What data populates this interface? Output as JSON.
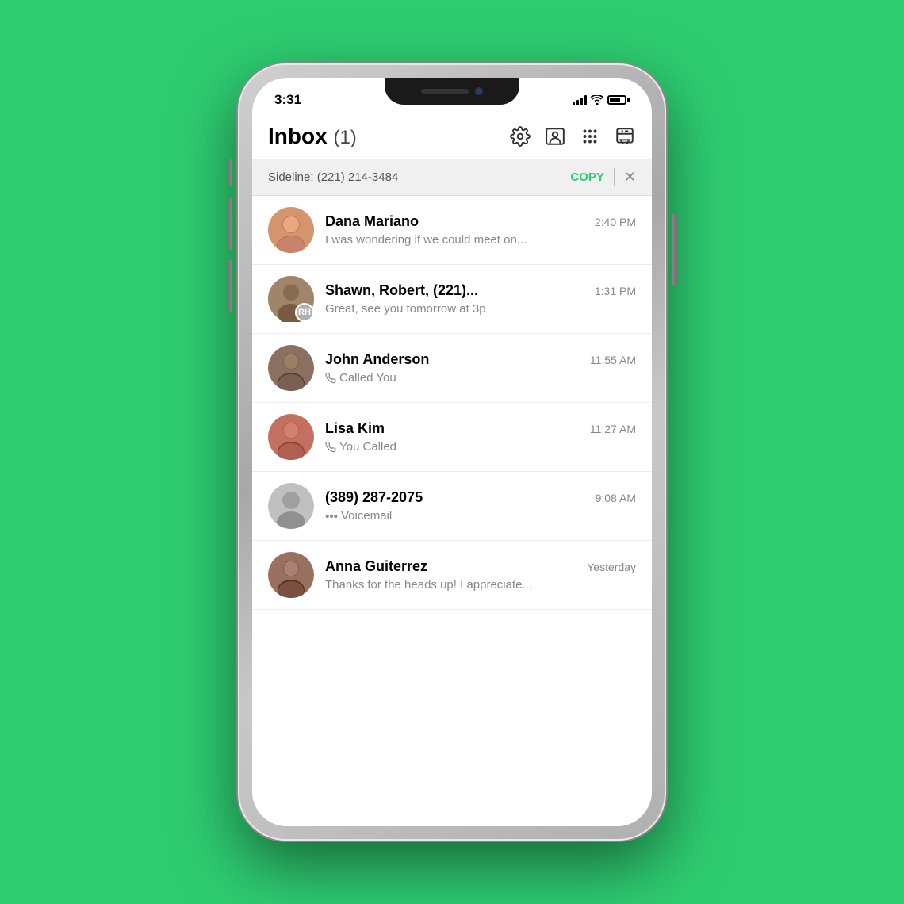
{
  "background_color": "#2ecc71",
  "status_bar": {
    "time": "3:31"
  },
  "header": {
    "title": "Inbox",
    "count": "(1)"
  },
  "sideline_banner": {
    "label": "Sideline: (221) 214-3484",
    "copy_btn": "COPY"
  },
  "conversations": [
    {
      "id": "dana",
      "name": "Dana Mariano",
      "time": "2:40 PM",
      "preview": "I was wondering if we could meet on...",
      "has_phone_icon": false,
      "unread": true,
      "avatar_type": "photo",
      "avatar_color": "#c9956a"
    },
    {
      "id": "shawn",
      "name": "Shawn, Robert, (221)...",
      "time": "1:31 PM",
      "preview": "Great, see you tomorrow at 3p",
      "has_phone_icon": false,
      "unread": false,
      "avatar_type": "initials",
      "avatar_initials": "RH",
      "avatar_color": "#a0856a"
    },
    {
      "id": "john",
      "name": "John Anderson",
      "time": "11:55 AM",
      "preview": "Called You",
      "has_phone_icon": true,
      "unread": false,
      "avatar_type": "photo",
      "avatar_color": "#8a6a4a"
    },
    {
      "id": "lisa",
      "name": "Lisa Kim",
      "time": "11:27 AM",
      "preview": "You Called",
      "has_phone_icon": true,
      "unread": false,
      "avatar_type": "photo",
      "avatar_color": "#c47060"
    },
    {
      "id": "unknown",
      "name": "(389) 287-2075",
      "time": "9:08 AM",
      "preview": "Voicemail",
      "has_phone_icon": true,
      "has_voicemail_icon": true,
      "unread": false,
      "avatar_type": "unknown",
      "avatar_color": "#c0c0c0"
    },
    {
      "id": "anna",
      "name": "Anna Guiterrez",
      "time": "Yesterday",
      "preview": "Thanks for the heads up! I appreciate...",
      "has_phone_icon": false,
      "unread": false,
      "avatar_type": "photo",
      "avatar_color": "#7a5a4a"
    }
  ]
}
